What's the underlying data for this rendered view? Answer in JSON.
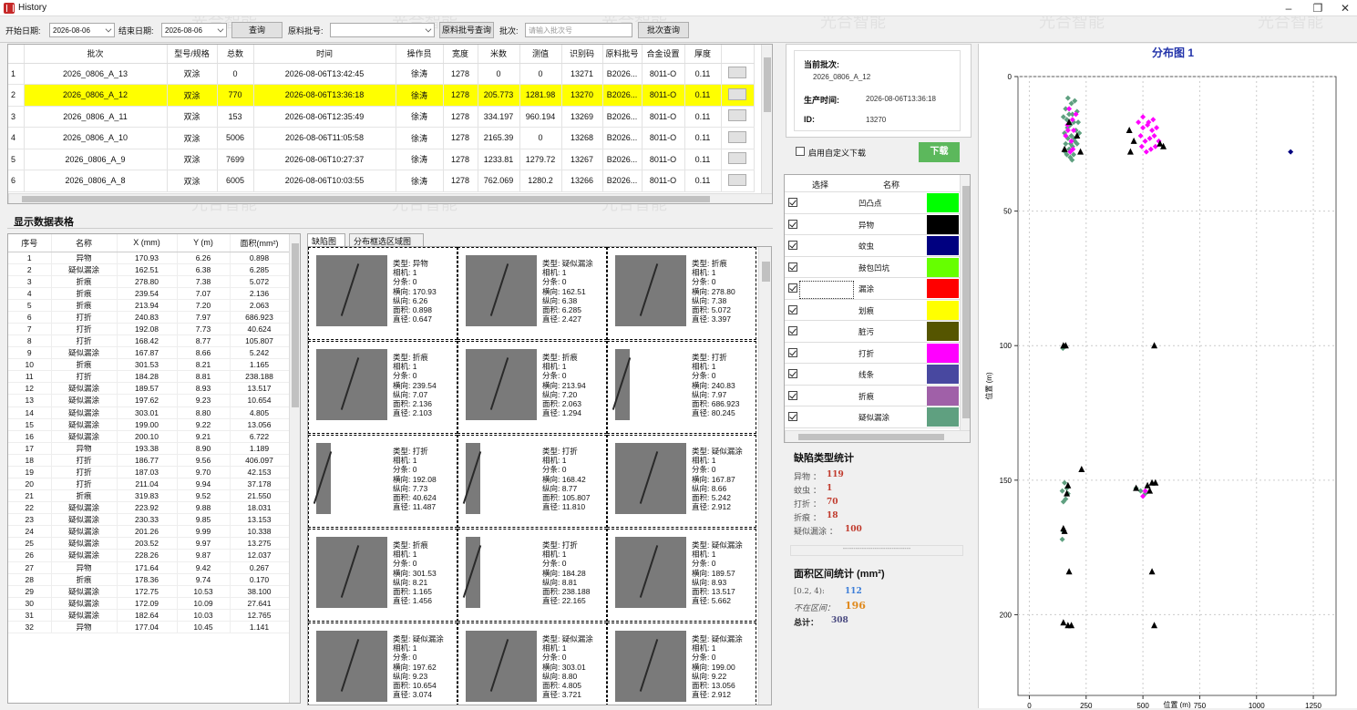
{
  "window": {
    "title": "History",
    "minimize": "–",
    "restore": "❐",
    "close": "✕"
  },
  "toolbar": {
    "start_label": "开始日期:",
    "start_date": "2026-08-06",
    "end_label": "结束日期:",
    "end_date": "2026-08-06",
    "query_btn": "查询",
    "material_label": "原料批号:",
    "material_value": "",
    "material_query_btn": "原料批号查询",
    "batch_label": "批次:",
    "batch_placeholder": "请输入批次号",
    "batch_query_btn": "批次查询"
  },
  "batch_table": {
    "headers": [
      "",
      "批次",
      "型号/规格",
      "总数",
      "时间",
      "操作员",
      "宽度",
      "米数",
      "测值",
      "识别码",
      "原料批号",
      "合金设置",
      "厚度",
      ""
    ],
    "rows": [
      [
        "1",
        "2026_0806_A_13",
        "双涂",
        "0",
        "2026-08-06T13:42:45",
        "徐涛",
        "1278",
        "0",
        "0",
        "13271",
        "B2026...",
        "8011-O",
        "0.11"
      ],
      [
        "2",
        "2026_0806_A_12",
        "双涂",
        "770",
        "2026-08-06T13:36:18",
        "徐涛",
        "1278",
        "205.773",
        "1281.98",
        "13270",
        "B2026...",
        "8011-O",
        "0.11"
      ],
      [
        "3",
        "2026_0806_A_11",
        "双涂",
        "153",
        "2026-08-06T12:35:49",
        "徐涛",
        "1278",
        "334.197",
        "960.194",
        "13269",
        "B2026...",
        "8011-O",
        "0.11"
      ],
      [
        "4",
        "2026_0806_A_10",
        "双涂",
        "5006",
        "2026-08-06T11:05:58",
        "徐涛",
        "1278",
        "2165.39",
        "0",
        "13268",
        "B2026...",
        "8011-O",
        "0.11"
      ],
      [
        "5",
        "2026_0806_A_9",
        "双涂",
        "7699",
        "2026-08-06T10:27:37",
        "徐涛",
        "1278",
        "1233.81",
        "1279.72",
        "13267",
        "B2026...",
        "8011-O",
        "0.11"
      ],
      [
        "6",
        "2026_0806_A_8",
        "双涂",
        "6005",
        "2026-08-06T10:03:55",
        "徐涛",
        "1278",
        "762.069",
        "1280.2",
        "13266",
        "B2026...",
        "8011-O",
        "0.11"
      ]
    ],
    "selected_row": 1
  },
  "section_title": "显示数据表格",
  "data_table": {
    "headers": [
      "序号",
      "名称",
      "X (mm)",
      "Y (m)",
      "面积(mm²)"
    ],
    "rows": [
      [
        "1",
        "异物",
        "170.93",
        "6.26",
        "0.898"
      ],
      [
        "2",
        "疑似漏涂",
        "162.51",
        "6.38",
        "6.285"
      ],
      [
        "3",
        "折痕",
        "278.80",
        "7.38",
        "5.072"
      ],
      [
        "4",
        "折痕",
        "239.54",
        "7.07",
        "2.136"
      ],
      [
        "5",
        "折痕",
        "213.94",
        "7.20",
        "2.063"
      ],
      [
        "6",
        "打折",
        "240.83",
        "7.97",
        "686.923"
      ],
      [
        "7",
        "打折",
        "192.08",
        "7.73",
        "40.624"
      ],
      [
        "8",
        "打折",
        "168.42",
        "8.77",
        "105.807"
      ],
      [
        "9",
        "疑似漏涂",
        "167.87",
        "8.66",
        "5.242"
      ],
      [
        "10",
        "折痕",
        "301.53",
        "8.21",
        "1.165"
      ],
      [
        "11",
        "打折",
        "184.28",
        "8.81",
        "238.188"
      ],
      [
        "12",
        "疑似漏涂",
        "189.57",
        "8.93",
        "13.517"
      ],
      [
        "13",
        "疑似漏涂",
        "197.62",
        "9.23",
        "10.654"
      ],
      [
        "14",
        "疑似漏涂",
        "303.01",
        "8.80",
        "4.805"
      ],
      [
        "15",
        "疑似漏涂",
        "199.00",
        "9.22",
        "13.056"
      ],
      [
        "16",
        "疑似漏涂",
        "200.10",
        "9.21",
        "6.722"
      ],
      [
        "17",
        "异物",
        "193.38",
        "8.90",
        "1.189"
      ],
      [
        "18",
        "打折",
        "186.77",
        "9.56",
        "406.097"
      ],
      [
        "19",
        "打折",
        "187.03",
        "9.70",
        "42.153"
      ],
      [
        "20",
        "打折",
        "211.04",
        "9.94",
        "37.178"
      ],
      [
        "21",
        "折痕",
        "319.83",
        "9.52",
        "21.550"
      ],
      [
        "22",
        "疑似漏涂",
        "223.92",
        "9.88",
        "18.031"
      ],
      [
        "23",
        "疑似漏涂",
        "230.33",
        "9.85",
        "13.153"
      ],
      [
        "24",
        "疑似漏涂",
        "201.26",
        "9.99",
        "10.338"
      ],
      [
        "25",
        "疑似漏涂",
        "203.52",
        "9.97",
        "13.275"
      ],
      [
        "26",
        "疑似漏涂",
        "228.26",
        "9.87",
        "12.037"
      ],
      [
        "27",
        "异物",
        "171.64",
        "9.42",
        "0.267"
      ],
      [
        "28",
        "折痕",
        "178.36",
        "9.74",
        "0.170"
      ],
      [
        "29",
        "疑似漏涂",
        "172.75",
        "10.53",
        "38.100"
      ],
      [
        "30",
        "疑似漏涂",
        "172.09",
        "10.09",
        "27.641"
      ],
      [
        "31",
        "疑似漏涂",
        "182.64",
        "10.03",
        "12.765"
      ],
      [
        "32",
        "异物",
        "177.04",
        "10.45",
        "1.141"
      ]
    ]
  },
  "tabs": [
    "缺陷图",
    "分布框选区域图"
  ],
  "grid": {
    "keys": [
      "类型: ",
      "相机: ",
      "分条: ",
      "横向: ",
      "纵向: ",
      "面积: ",
      "直径: "
    ],
    "cells": [
      [
        "异物",
        "1",
        "0",
        "170.93",
        "6.26",
        "0.898",
        "0.647"
      ],
      [
        "疑似漏涂",
        "1",
        "0",
        "162.51",
        "6.38",
        "6.285",
        "2.427"
      ],
      [
        "折痕",
        "1",
        "0",
        "278.80",
        "7.38",
        "5.072",
        "3.397"
      ],
      [
        "折痕",
        "1",
        "0",
        "239.54",
        "7.07",
        "2.136",
        "2.103"
      ],
      [
        "折痕",
        "1",
        "0",
        "213.94",
        "7.20",
        "2.063",
        "1.294"
      ],
      [
        "打折",
        "1",
        "0",
        "240.83",
        "7.97",
        "686.923",
        "80.245"
      ],
      [
        "打折",
        "1",
        "0",
        "192.08",
        "7.73",
        "40.624",
        "11.487"
      ],
      [
        "打折",
        "1",
        "0",
        "168.42",
        "8.77",
        "105.807",
        "11.810"
      ],
      [
        "疑似漏涂",
        "1",
        "0",
        "167.87",
        "8.66",
        "5.242",
        "2.912"
      ],
      [
        "折痕",
        "1",
        "0",
        "301.53",
        "8.21",
        "1.165",
        "1.456"
      ],
      [
        "打折",
        "1",
        "0",
        "184.28",
        "8.81",
        "238.188",
        "22.165"
      ],
      [
        "疑似漏涂",
        "1",
        "0",
        "189.57",
        "8.93",
        "13.517",
        "5.662"
      ],
      [
        "疑似漏涂",
        "1",
        "0",
        "197.62",
        "9.23",
        "10.654",
        "3.074"
      ],
      [
        "疑似漏涂",
        "1",
        "0",
        "303.01",
        "8.80",
        "4.805",
        "3.721"
      ],
      [
        "疑似漏涂",
        "1",
        "0",
        "199.00",
        "9.22",
        "13.056",
        "2.912"
      ]
    ]
  },
  "info": {
    "batch_label": "当前批次:",
    "batch_value": "2026_0806_A_12",
    "time_label": "生产时间:",
    "time_value": "2026-08-06T13:36:18",
    "id_label": "ID:",
    "id_value": "13270"
  },
  "download": {
    "custom_label": "启用自定义下载",
    "button": "下载"
  },
  "types": {
    "headers": [
      "选择",
      "名称"
    ],
    "items": [
      {
        "name": "凹凸点",
        "color": "#00ff00"
      },
      {
        "name": "异物",
        "color": "#000000"
      },
      {
        "name": "蚊虫",
        "color": "#000080"
      },
      {
        "name": "鼓包凹坑",
        "color": "#66ff00"
      },
      {
        "name": "漏涂",
        "color": "#ff0000"
      },
      {
        "name": "划痕",
        "color": "#ffff00"
      },
      {
        "name": "脏污",
        "color": "#555500"
      },
      {
        "name": "打折",
        "color": "#ff00ff"
      },
      {
        "name": "线条",
        "color": "#4848a0"
      },
      {
        "name": "折痕",
        "color": "#a060a8"
      },
      {
        "name": "疑似漏涂",
        "color": "#5fa080"
      }
    ]
  },
  "stats": {
    "title": "缺陷类型统计",
    "items": [
      {
        "label": "异物 ：",
        "value": "119"
      },
      {
        "label": "蚊虫 ：",
        "value": "1"
      },
      {
        "label": "打折 ：",
        "value": "70"
      },
      {
        "label": "折痕 ：",
        "value": "18"
      },
      {
        "label": "疑似漏涂 ：",
        "value": "100"
      }
    ],
    "divider": "--------------------------------",
    "area_title": "面积区间统计 (mm²)",
    "area_items": [
      {
        "label": "[0.2, 4):",
        "value": "112"
      },
      {
        "label": "不在区间：",
        "value": "196"
      }
    ],
    "total_label": "总计：",
    "total_value": "308"
  },
  "watermark": "光合智能",
  "chart_data": {
    "type": "scatter",
    "title": "分布图 1",
    "xlabel": "位置 (m)",
    "ylabel": "位置 (m)",
    "x_ticks": [
      "0",
      "250",
      "500",
      "750",
      "1000",
      "1250"
    ],
    "y_ticks": [
      "0",
      "50",
      "100",
      "150",
      "200"
    ],
    "xlim": [
      -50,
      1350
    ],
    "ylim": [
      0,
      230
    ],
    "series": [
      {
        "color": "#5fa080",
        "marker": "diamond",
        "points": [
          [
            160,
            12
          ],
          [
            170,
            8
          ],
          [
            185,
            10
          ],
          [
            200,
            9
          ],
          [
            210,
            13
          ],
          [
            150,
            15
          ],
          [
            165,
            16
          ],
          [
            180,
            18
          ],
          [
            195,
            17
          ],
          [
            205,
            20
          ],
          [
            155,
            21
          ],
          [
            170,
            23
          ],
          [
            185,
            22
          ],
          [
            200,
            24
          ],
          [
            160,
            25
          ],
          [
            175,
            27
          ],
          [
            190,
            26
          ],
          [
            210,
            25
          ],
          [
            165,
            29
          ],
          [
            180,
            30
          ],
          [
            195,
            29
          ],
          [
            175,
            14
          ],
          [
            190,
            14
          ],
          [
            168,
            19
          ],
          [
            182,
            25
          ],
          [
            198,
            23
          ],
          [
            215,
            17
          ],
          [
            220,
            21
          ],
          [
            158,
            28
          ],
          [
            188,
            31
          ],
          [
            145,
            154
          ],
          [
            155,
            151
          ],
          [
            160,
            157
          ],
          [
            150,
            158
          ],
          [
            165,
            153
          ],
          [
            170,
            155
          ],
          [
            490,
            154
          ],
          [
            510,
            155
          ],
          [
            470,
            153
          ],
          [
            150,
            169
          ],
          [
            145,
            172
          ],
          [
            148,
            101
          ]
        ]
      },
      {
        "color": "#ff00ff",
        "marker": "diamond",
        "points": [
          [
            175,
            12
          ],
          [
            190,
            16
          ],
          [
            205,
            14
          ],
          [
            170,
            20
          ],
          [
            185,
            24
          ],
          [
            160,
            22
          ],
          [
            195,
            20
          ],
          [
            180,
            28
          ],
          [
            480,
            17
          ],
          [
            500,
            19
          ],
          [
            520,
            18
          ],
          [
            540,
            20
          ],
          [
            560,
            19
          ],
          [
            490,
            22
          ],
          [
            510,
            24
          ],
          [
            530,
            23
          ],
          [
            550,
            22
          ],
          [
            570,
            24
          ],
          [
            495,
            26
          ],
          [
            515,
            28
          ],
          [
            535,
            27
          ],
          [
            555,
            26
          ],
          [
            500,
            15
          ],
          [
            525,
            17
          ],
          [
            545,
            16
          ],
          [
            510,
            154
          ],
          [
            500,
            156
          ],
          [
            192,
            27
          ],
          [
            168,
            18
          ]
        ]
      },
      {
        "color": "#000000",
        "marker": "triangle",
        "points": [
          [
            175,
            17
          ],
          [
            210,
            22
          ],
          [
            155,
            27
          ],
          [
            225,
            28
          ],
          [
            440,
            20
          ],
          [
            460,
            24
          ],
          [
            445,
            28
          ],
          [
            575,
            25
          ],
          [
            590,
            26
          ],
          [
            150,
            100
          ],
          [
            160,
            100
          ],
          [
            550,
            100
          ],
          [
            230,
            146
          ],
          [
            170,
            152
          ],
          [
            165,
            155
          ],
          [
            470,
            153
          ],
          [
            520,
            152
          ],
          [
            540,
            151
          ],
          [
            555,
            151
          ],
          [
            530,
            154
          ],
          [
            155,
            169
          ],
          [
            150,
            168
          ],
          [
            175,
            184
          ],
          [
            540,
            184
          ],
          [
            150,
            203
          ],
          [
            170,
            204
          ],
          [
            185,
            204
          ],
          [
            550,
            204
          ]
        ]
      },
      {
        "color": "#000080",
        "marker": "diamond",
        "points": [
          [
            1150,
            28
          ]
        ]
      }
    ]
  }
}
